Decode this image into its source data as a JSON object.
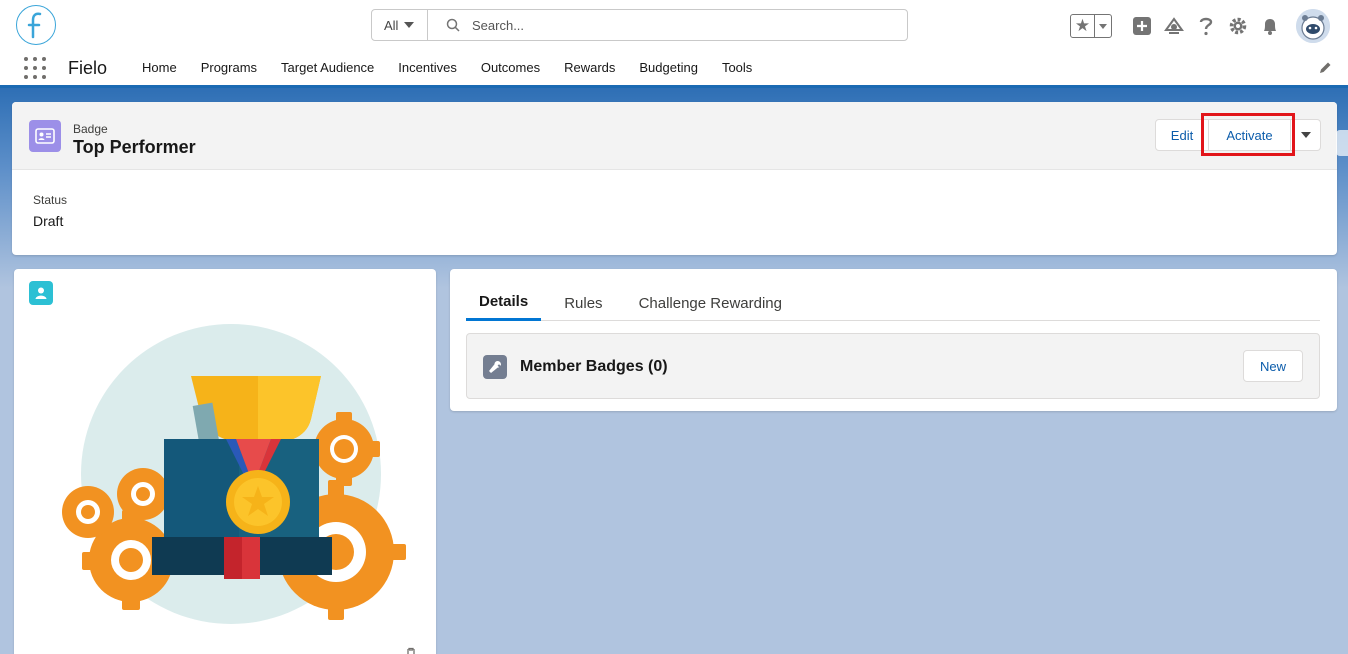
{
  "header": {
    "search_scope": "All",
    "search_placeholder": "Search...",
    "icons": [
      "favorites-star-icon",
      "favorites-dropdown-icon",
      "add-icon",
      "trailhead-icon",
      "help-icon",
      "setup-gear-icon",
      "notifications-bell-icon",
      "user-avatar"
    ]
  },
  "nav": {
    "app_name": "Fielo",
    "items": [
      "Home",
      "Programs",
      "Target Audience",
      "Incentives",
      "Outcomes",
      "Rewards",
      "Budgeting",
      "Tools"
    ]
  },
  "record": {
    "object_type": "Badge",
    "name": "Top Performer",
    "actions": {
      "edit": "Edit",
      "activate": "Activate"
    },
    "fields": {
      "status_label": "Status",
      "status_value": "Draft"
    }
  },
  "tabs": {
    "details": "Details",
    "rules": "Rules",
    "challenge": "Challenge Rewarding"
  },
  "related": {
    "title": "Member Badges (0)",
    "new_label": "New"
  },
  "colors": {
    "brand": "#0176d3",
    "highlight": "#e2151a",
    "badge_icon": "#9c8fe8",
    "contact_icon": "#2cc0d4"
  }
}
